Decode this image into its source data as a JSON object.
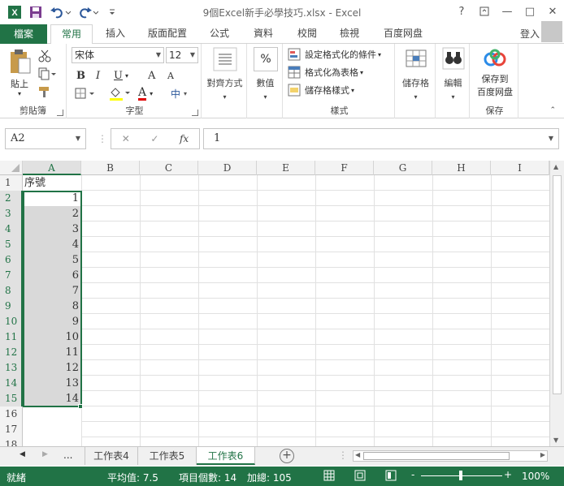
{
  "window": {
    "title": "9個Excel新手必學技巧.xlsx - Excel",
    "help": "?",
    "restore": "□",
    "minimize": "—",
    "close": "✕"
  },
  "tabs": {
    "file": "檔案",
    "home": "常用",
    "insert": "插入",
    "page_layout": "版面配置",
    "formulas": "公式",
    "data": "資料",
    "review": "校閱",
    "view": "檢視",
    "baidu": "百度网盘",
    "login": "登入"
  },
  "ribbon": {
    "clipboard": {
      "label": "剪貼簿",
      "paste": "貼上"
    },
    "font": {
      "label": "字型",
      "font_name": "宋体",
      "font_size": "12",
      "bold": "B",
      "italic": "I",
      "underline": "U",
      "grow": "A",
      "shrink": "A",
      "font_color": "A",
      "phonetic": "中"
    },
    "alignment": {
      "label": "對齊方式"
    },
    "number": {
      "label": "數值",
      "percent": "%"
    },
    "styles": {
      "label": "樣式",
      "conditional": "設定格式化的條件",
      "format_table": "格式化為表格",
      "cell_styles": "儲存格樣式"
    },
    "cells": {
      "label": "儲存格"
    },
    "editing": {
      "label": "編輯"
    },
    "save": {
      "label": "保存",
      "save_to": "保存到",
      "baidu": "百度网盘"
    }
  },
  "formula_bar": {
    "name_box": "A2",
    "cancel": "✕",
    "enter": "✓",
    "fx": "fx",
    "value": "1"
  },
  "grid": {
    "columns": [
      "A",
      "B",
      "C",
      "D",
      "E",
      "F",
      "G",
      "H",
      "I"
    ],
    "rows": [
      {
        "num": "1",
        "a": "序號"
      },
      {
        "num": "2",
        "a": "1"
      },
      {
        "num": "3",
        "a": "2"
      },
      {
        "num": "4",
        "a": "3"
      },
      {
        "num": "5",
        "a": "4"
      },
      {
        "num": "6",
        "a": "5"
      },
      {
        "num": "7",
        "a": "6"
      },
      {
        "num": "8",
        "a": "7"
      },
      {
        "num": "9",
        "a": "8"
      },
      {
        "num": "10",
        "a": "9"
      },
      {
        "num": "11",
        "a": "10"
      },
      {
        "num": "12",
        "a": "11"
      },
      {
        "num": "13",
        "a": "12"
      },
      {
        "num": "14",
        "a": "13"
      },
      {
        "num": "15",
        "a": "14"
      },
      {
        "num": "16",
        "a": ""
      },
      {
        "num": "17",
        "a": ""
      },
      {
        "num": "18",
        "a": ""
      }
    ]
  },
  "sheets": {
    "more": "...",
    "tab4": "工作表4",
    "tab5": "工作表5",
    "tab6": "工作表6",
    "add": "+"
  },
  "status": {
    "ready": "就緒",
    "average": "平均值: 7.5",
    "count": "項目個數: 14",
    "sum": "加總: 105",
    "zoom_minus": "-",
    "zoom_plus": "+",
    "zoom": "100%"
  },
  "colors": {
    "accent": "#217346",
    "selection_fill": "#d9d9d9"
  }
}
